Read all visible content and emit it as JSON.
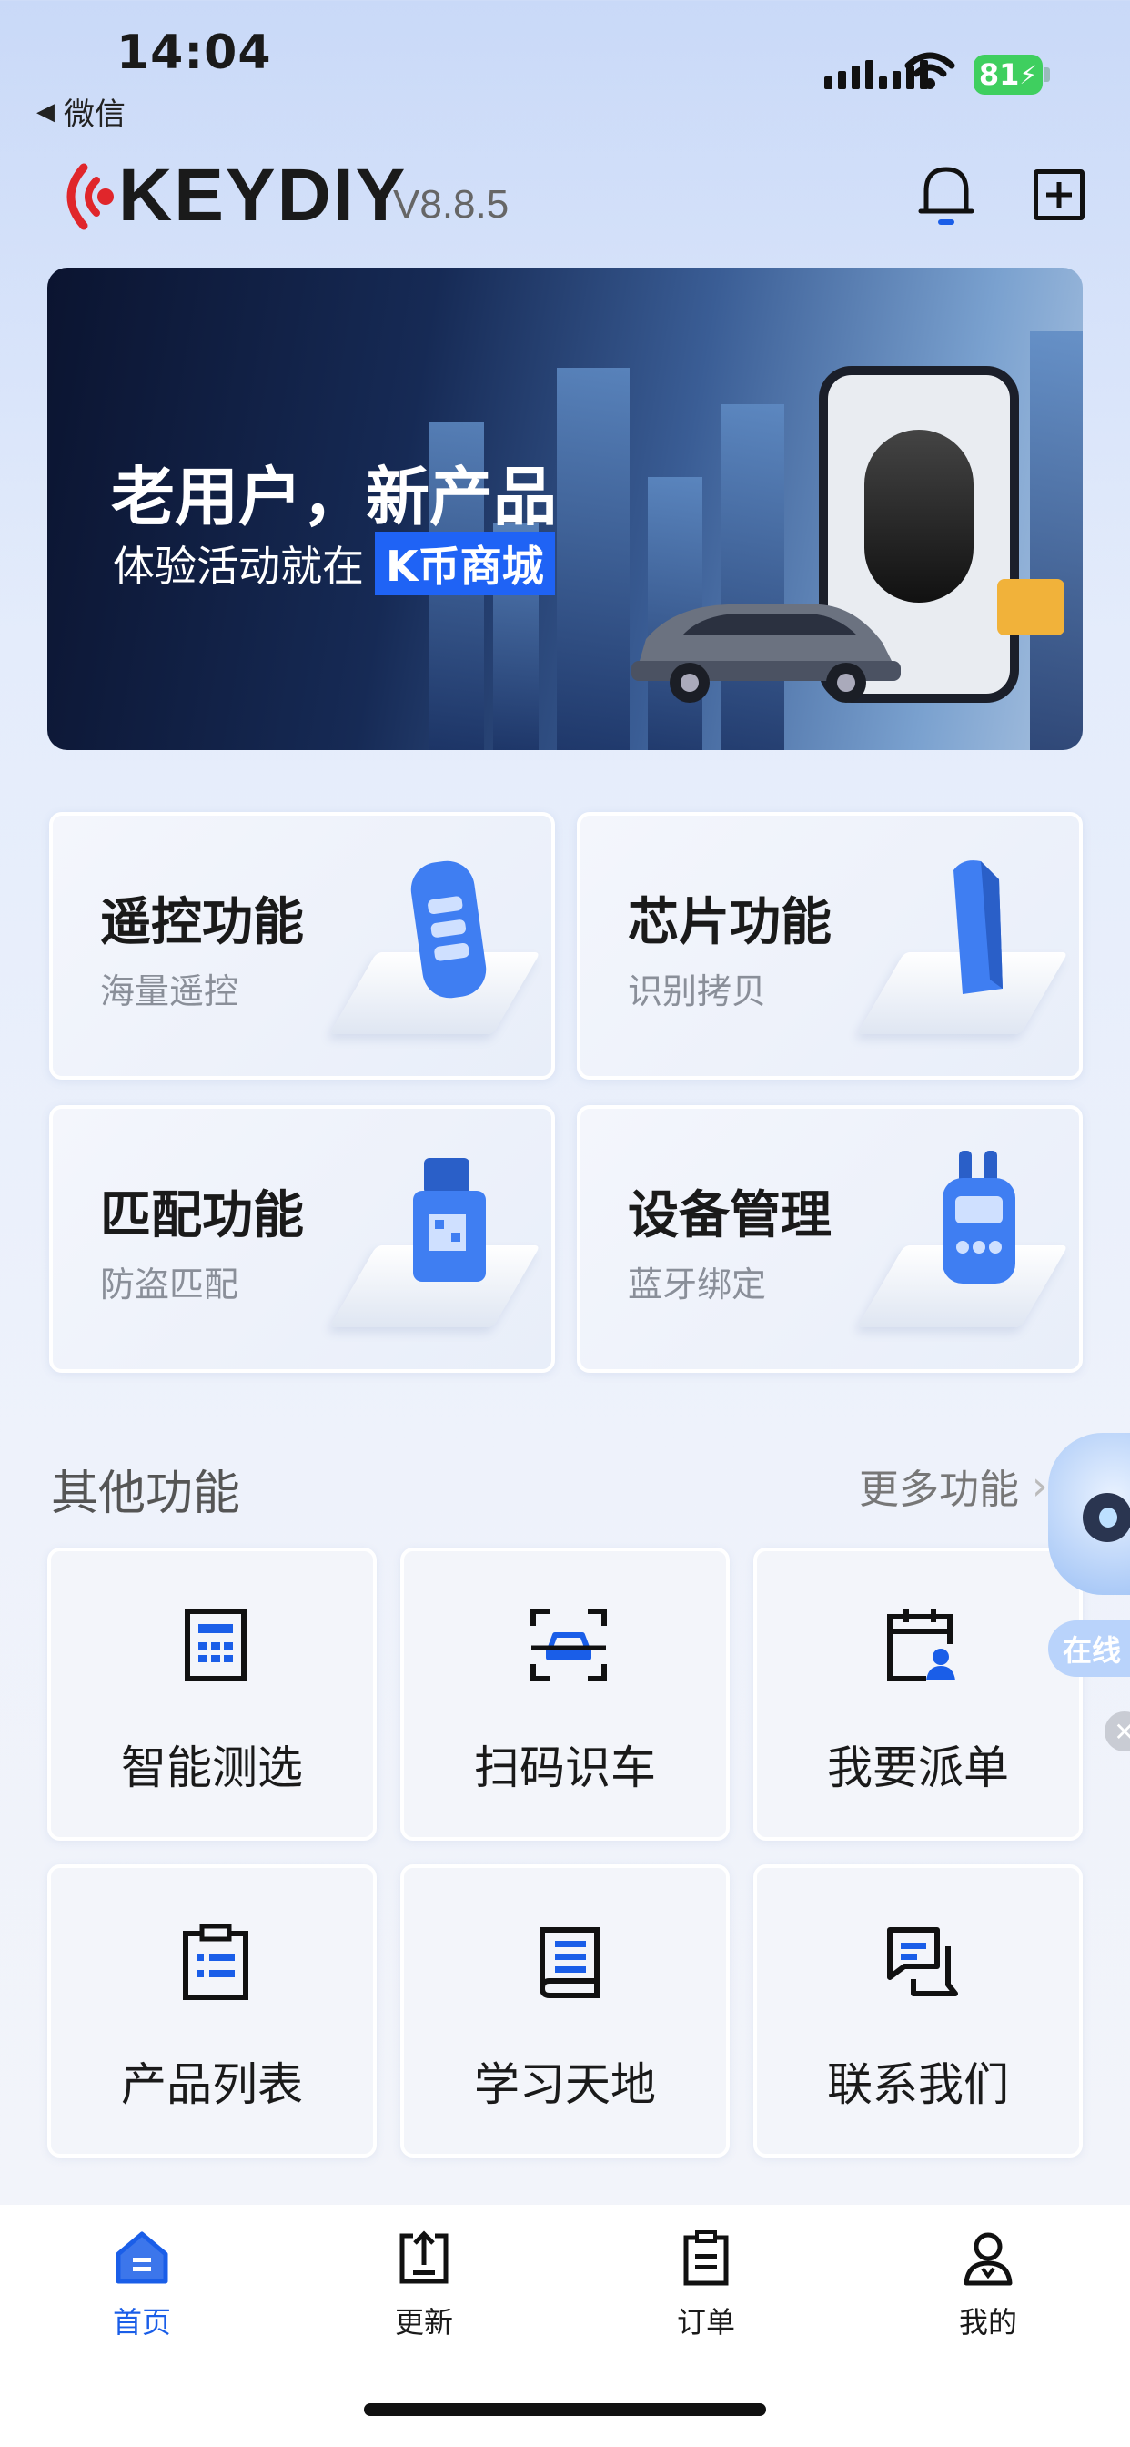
{
  "status_bar": {
    "time": "14:04",
    "back_app": "微信",
    "battery": "81"
  },
  "header": {
    "brand": "KEYDIY",
    "version": "V8.8.5"
  },
  "banner": {
    "title": "老用户，新产品",
    "subtitle": "体验活动就在",
    "highlight": "K币商城"
  },
  "features": [
    {
      "title": "遥控功能",
      "subtitle": "海量遥控",
      "icon": "remote-key-icon"
    },
    {
      "title": "芯片功能",
      "subtitle": "识别拷贝",
      "icon": "chip-icon"
    },
    {
      "title": "匹配功能",
      "subtitle": "防盗匹配",
      "icon": "obd-connector-icon"
    },
    {
      "title": "设备管理",
      "subtitle": "蓝牙绑定",
      "icon": "device-icon"
    }
  ],
  "other": {
    "title": "其他功能",
    "more": "更多功能",
    "items": [
      {
        "label": "智能测选",
        "icon": "calculator-icon"
      },
      {
        "label": "扫码识车",
        "icon": "scan-car-icon"
      },
      {
        "label": "我要派单",
        "icon": "dispatch-calendar-icon"
      },
      {
        "label": "产品列表",
        "icon": "clipboard-list-icon"
      },
      {
        "label": "学习天地",
        "icon": "book-icon"
      },
      {
        "label": "联系我们",
        "icon": "chat-icon"
      }
    ]
  },
  "assistant": {
    "status": "在线"
  },
  "tabbar": [
    {
      "label": "首页",
      "icon": "home-icon",
      "active": true
    },
    {
      "label": "更新",
      "icon": "update-icon",
      "active": false
    },
    {
      "label": "订单",
      "icon": "order-icon",
      "active": false
    },
    {
      "label": "我的",
      "icon": "profile-icon",
      "active": false
    }
  ],
  "colors": {
    "accent": "#1a5ee8",
    "brand_red": "#e0262b",
    "battery": "#3fcf5f"
  }
}
